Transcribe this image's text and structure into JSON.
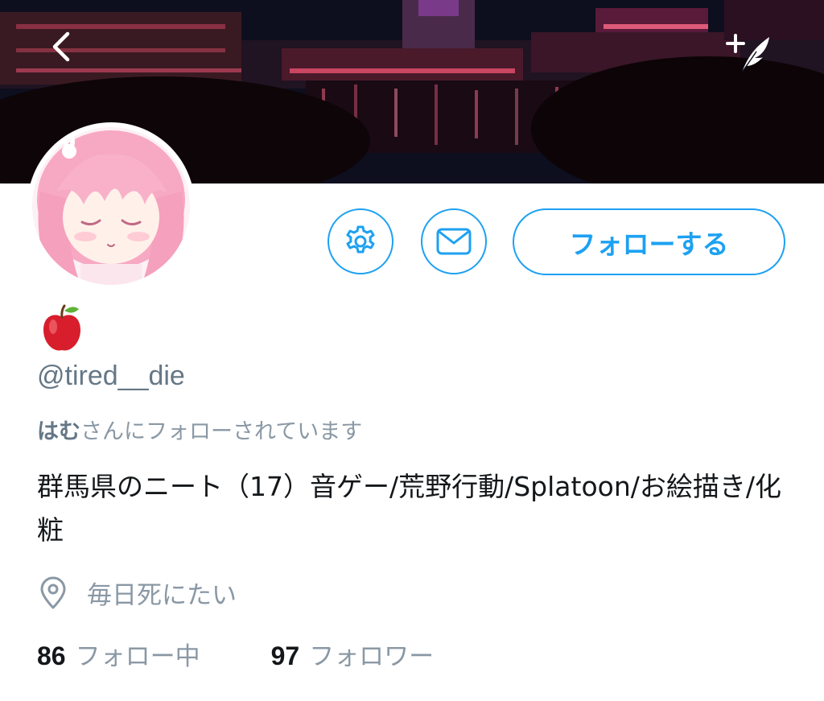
{
  "profile": {
    "display_name": "🍎",
    "handle": "@tired__die",
    "followed_by_name": "はむ",
    "followed_by_suffix": "さんにフォローされています",
    "bio": "群馬県のニート（17）音ゲー/荒野行動/Splatoon/お絵描き/化粧",
    "location": "毎日死にたい"
  },
  "actions": {
    "follow_label": "フォローする"
  },
  "stats": {
    "following_count": "86",
    "following_label": "フォロー中",
    "followers_count": "97",
    "followers_label": "フォロワー"
  },
  "icons": {
    "back": "chevron-left-icon",
    "compose": "compose-tweet-icon",
    "settings": "gear-icon",
    "message": "envelope-icon",
    "location": "location-pin-icon"
  },
  "colors": {
    "accent": "#1da1f2",
    "secondary_text": "#657786",
    "primary_text": "#14171a"
  }
}
